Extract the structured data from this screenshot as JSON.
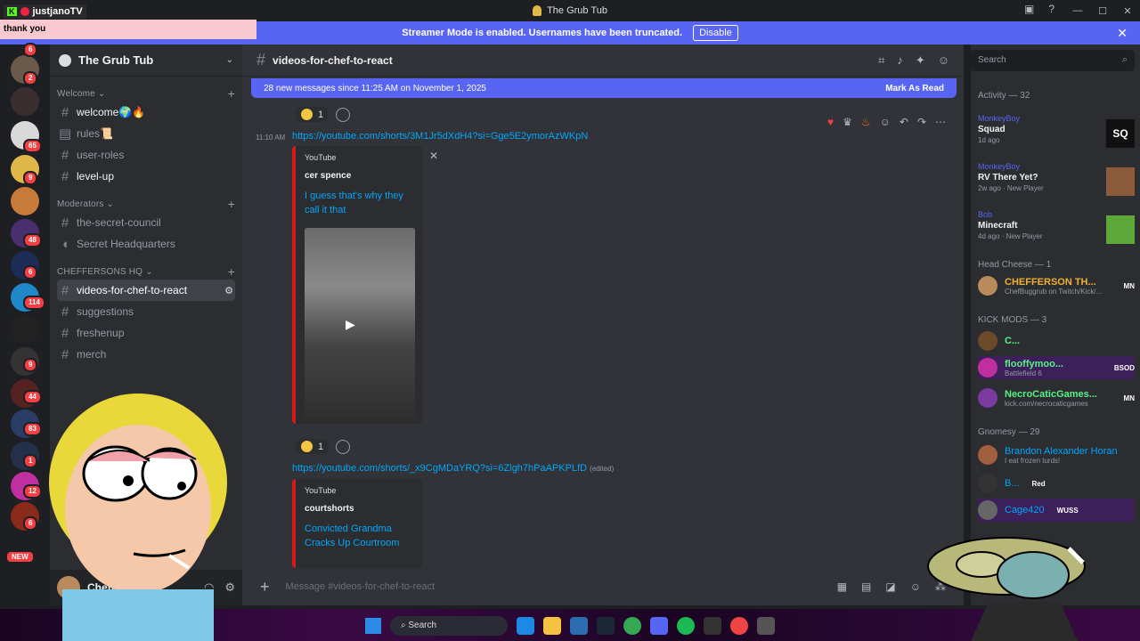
{
  "stream": {
    "channel_tag": "justjanoTV",
    "chat_message": "thank you"
  },
  "window": {
    "title": "The Grub Tub"
  },
  "banner": {
    "text": "Streamer Mode is enabled. Usernames have been truncated.",
    "disable_label": "Disable"
  },
  "rail": {
    "badges": [
      "6",
      "2",
      "65",
      "9",
      "48",
      "6",
      "114",
      "9",
      "44",
      "83",
      "1",
      "12",
      "6"
    ],
    "new_label": "NEW"
  },
  "sidebar": {
    "server_name": "The Grub Tub",
    "categories": {
      "welcome": "Welcome",
      "moderators": "Moderators",
      "hq": "CHEFFERSONS HQ"
    },
    "channels": {
      "welcome": "welcome🌍🔥",
      "rules": "rules📜",
      "user_roles": "user-roles",
      "level_up": "level-up",
      "secret_council": "the-secret-council",
      "secret_hq": "Secret Headquarters",
      "videos": "videos-for-chef-to-react",
      "suggestions": "suggestions",
      "freshenup": "freshenup",
      "merch": "merch"
    },
    "user": {
      "name": "Cheffers"
    }
  },
  "chat": {
    "channel_name": "videos-for-chef-to-react",
    "new_messages": "28 new messages since 11:25 AM on November 1, 2025",
    "mark_as_read": "Mark As Read",
    "reaction_count_1": "1",
    "reaction_count_2": "1",
    "time": "11:10 AM",
    "link_1": "https://youtube.com/shorts/3M1Jr5dXdH4?si=Gge5E2ymorAzWKpN",
    "embed_1": {
      "provider": "YouTube",
      "author": "cer spence",
      "title": "I guess that's why they call it that"
    },
    "link_2": "https://youtube.com/shorts/_x9CgMDaYRQ?si=6Zlgh7hPaAPKPLfD",
    "edited": "(edited)",
    "embed_2": {
      "provider": "YouTube",
      "author": "courtshorts",
      "title": "Convicted Grandma Cracks Up Courtroom"
    },
    "composer_placeholder": "Message #videos-for-chef-to-react"
  },
  "right": {
    "search_placeholder": "Search",
    "activity_header": "Activity — 32",
    "activities": [
      {
        "who": "MonkeyBoy",
        "what": "Squad",
        "when": "1d ago",
        "art_label": "SQ"
      },
      {
        "who": "MonkeyBoy",
        "what": "RV There Yet?",
        "when": "2w ago",
        "new_player": "New Player"
      },
      {
        "who": "Bob",
        "what": "Minecraft",
        "when": "4d ago",
        "new_player": "New Player"
      }
    ],
    "head_cheese_header": "Head Cheese — 1",
    "head_cheese": {
      "name": "CHEFFERSON TH...",
      "tag": "MN",
      "sub": "ChefBuggrub on Twitch/Kick/..."
    },
    "kick_mods_header": "KICK MODS — 3",
    "kick_mods": [
      {
        "name": "C...",
        "tag": "",
        "sub": ""
      },
      {
        "name": "flooffymoo...",
        "tag": "BSOD",
        "sub": "Battlefield 6"
      },
      {
        "name": "NecroCaticGames...",
        "tag": "MN",
        "sub": "kick.com/necrocaticgames"
      }
    ],
    "gnomesy_header": "Gnomesy — 29",
    "gnomesy": [
      {
        "name": "Brandon Alexander Horan",
        "tag": "",
        "sub": "I eat frozen turds!"
      },
      {
        "name": "B...",
        "tag": "Red",
        "sub": ""
      },
      {
        "name": "Cage420",
        "tag": "WUSS",
        "sub": ""
      }
    ]
  },
  "taskbar": {
    "search_label": "Search"
  },
  "colors": {
    "accent": "#5865f2",
    "background": "#313338",
    "sidebar": "#2b2d31",
    "link": "#00a8fc",
    "danger": "#f23f43"
  }
}
